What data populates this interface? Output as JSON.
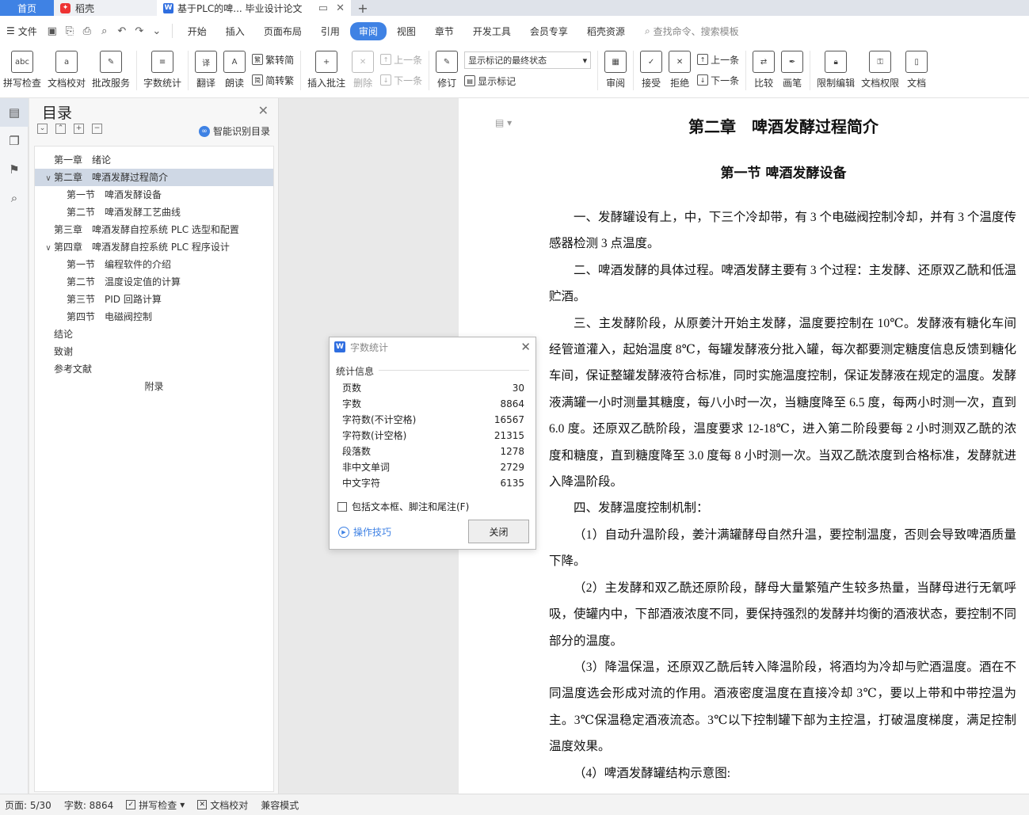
{
  "tabs": {
    "home": "首页",
    "daoke": "稻壳",
    "doc": "基于PLC的啤... 毕业设计论文"
  },
  "menu": {
    "file": "文件",
    "items": [
      "开始",
      "插入",
      "页面布局",
      "引用",
      "审阅",
      "视图",
      "章节",
      "开发工具",
      "会员专享",
      "稻壳资源"
    ],
    "active": "审阅",
    "search": "查找命令、搜索模板"
  },
  "ribbon": {
    "spell": "拼写检查",
    "doc_check": "文档校对",
    "correction": "批改服务",
    "word_count": "字数统计",
    "translate": "翻译",
    "read_aloud": "朗读",
    "to_traditional": "繁转简",
    "to_simplified": "简转繁",
    "insert_comment": "插入批注",
    "delete": "删除",
    "prev_comment": "上一条",
    "next_comment": "下一条",
    "revise": "修订",
    "markup_select": "显示标记的最终状态",
    "show_markup": "显示标记",
    "review": "审阅",
    "accept": "接受",
    "reject": "拒绝",
    "prev_change": "上一条",
    "next_change": "下一条",
    "compare": "比较",
    "pen": "画笔",
    "restrict": "限制编辑",
    "permission": "文档权限",
    "more": "文档"
  },
  "toc": {
    "title": "目录",
    "smart": "智能识别目录",
    "items": [
      {
        "text": "第一章　绪论",
        "level": 1,
        "caret": ""
      },
      {
        "text": "第二章　啤酒发酵过程简介",
        "level": 1,
        "caret": "∨",
        "selected": true
      },
      {
        "text": "第一节　啤酒发酵设备",
        "level": 2,
        "caret": ""
      },
      {
        "text": "第二节　啤酒发酵工艺曲线",
        "level": 2,
        "caret": ""
      },
      {
        "text": "第三章　啤酒发酵自控系统 PLC 选型和配置",
        "level": 1,
        "caret": ""
      },
      {
        "text": "第四章　啤酒发酵自控系统 PLC 程序设计",
        "level": 1,
        "caret": "∨"
      },
      {
        "text": "第一节　编程软件的介绍",
        "level": 2,
        "caret": ""
      },
      {
        "text": "第二节　温度设定值的计算",
        "level": 2,
        "caret": ""
      },
      {
        "text": "第三节　PID 回路计算",
        "level": 2,
        "caret": ""
      },
      {
        "text": "第四节　电磁阀控制",
        "level": 2,
        "caret": ""
      },
      {
        "text": "结论",
        "level": 1,
        "caret": ""
      },
      {
        "text": "致谢",
        "level": 1,
        "caret": ""
      },
      {
        "text": "参考文献",
        "level": 1,
        "caret": ""
      },
      {
        "text": "附录",
        "level": 0,
        "caret": ""
      }
    ]
  },
  "document": {
    "chapter_title": "第二章　啤酒发酵过程简介",
    "section_title": "第一节  啤酒发酵设备",
    "paragraphs": [
      "一、发酵罐设有上，中，下三个冷却带，有 3 个电磁阀控制冷却，并有 3 个温度传感器检测 3 点温度。",
      "二、啤酒发酵的具体过程。啤酒发酵主要有 3 个过程：主发酵、还原双乙酰和低温贮酒。",
      "三、主发酵阶段，从原姜汁开始主发酵，温度要控制在 10℃。发酵液有糖化车间经管道灌入，起始温度 8℃，每罐发酵液分批入罐，每次都要测定糖度信息反馈到糖化车间，保证整罐发酵液符合标准，同时实施温度控制，保证发酵液在规定的温度。发酵液满罐一小时测量其糖度，每八小时一次，当糖度降至 6.5 度，每两小时测一次，直到 6.0 度。还原双乙酰阶段，温度要求 12-18℃，进入第二阶段要每 2 小时测双乙酰的浓度和糖度，直到糖度降至 3.0 度每 8 小时测一次。当双乙酰浓度到合格标准，发酵就进入降温阶段。",
      "四、发酵温度控制机制：",
      "（1）自动升温阶段，姜汁满罐酵母自然升温，要控制温度，否则会导致啤酒质量下降。",
      "（2）主发酵和双乙酰还原阶段，酵母大量繁殖产生较多热量，当酵母进行无氧呼吸，使罐内中，下部酒液浓度不同，要保持强烈的发酵并均衡的酒液状态，要控制不同部分的温度。",
      "（3）降温保温，还原双乙酰后转入降温阶段，将酒均为冷却与贮酒温度。酒在不同温度选会形成对流的作用。酒液密度温度在直接冷却 3℃，要以上带和中带控温为主。3℃保温稳定酒液流态。3℃以下控制罐下部为主控温，打破温度梯度，满足控制温度效果。",
      "（4）啤酒发酵罐结构示意图:"
    ]
  },
  "dialog": {
    "title": "字数统计",
    "section": "统计信息",
    "rows": [
      {
        "label": "页数",
        "value": "30"
      },
      {
        "label": "字数",
        "value": "8864"
      },
      {
        "label": "字符数(不计空格)",
        "value": "16567"
      },
      {
        "label": "字符数(计空格)",
        "value": "21315"
      },
      {
        "label": "段落数",
        "value": "1278"
      },
      {
        "label": "非中文单词",
        "value": "2729"
      },
      {
        "label": "中文字符",
        "value": "6135"
      }
    ],
    "checkbox": "包括文本框、脚注和尾注(F)",
    "tips": "操作技巧",
    "close": "关闭"
  },
  "status": {
    "page": "页面: 5/30",
    "words": "字数: 8864",
    "spell": "拼写检查",
    "check": "文档校对",
    "compat": "兼容模式"
  },
  "colors": {
    "accent": "#3f82e4",
    "toc_selected": "#cfd8e5"
  }
}
